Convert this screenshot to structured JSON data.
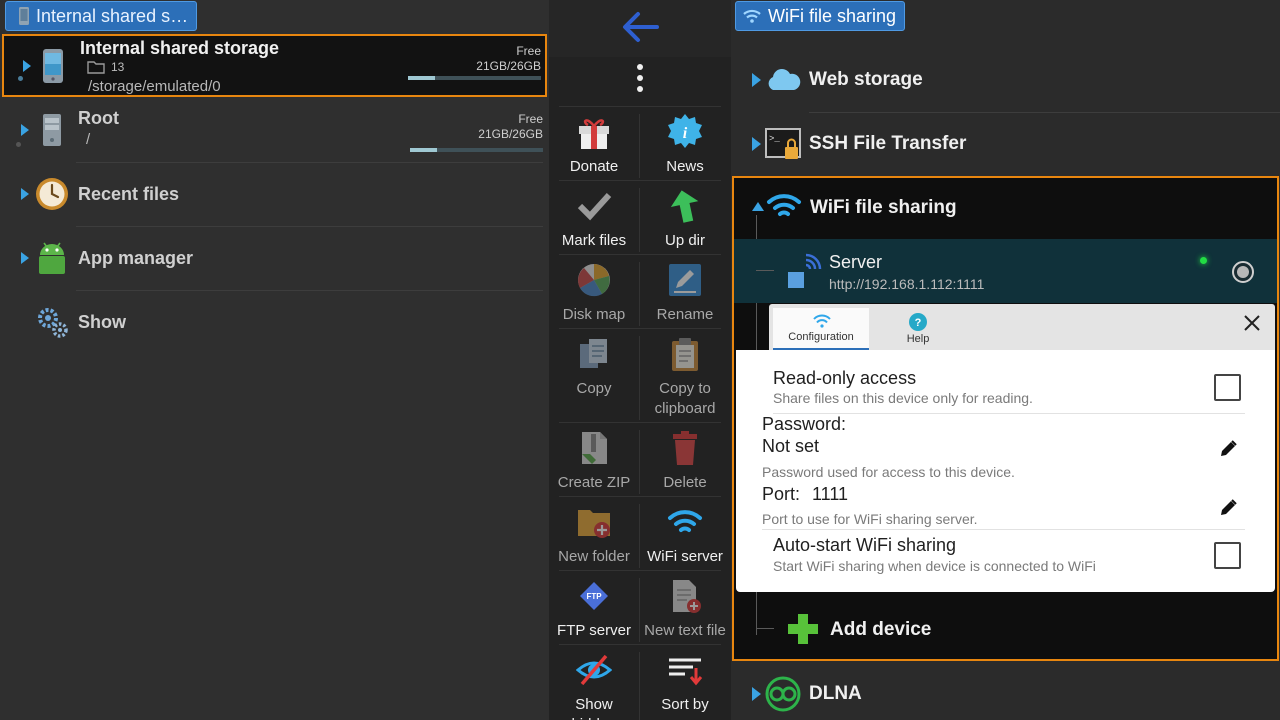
{
  "left": {
    "path_chip": "Internal shared s…",
    "items": [
      {
        "title": "Internal shared storage",
        "folder_count": "13",
        "path": "/storage/emulated/0",
        "free_label": "Free",
        "free_value": "21GB/26GB",
        "used_fraction": 0.2
      },
      {
        "title": "Root",
        "path": "/",
        "free_label": "Free",
        "free_value": "21GB/26GB",
        "used_fraction": 0.2
      },
      {
        "title": "Recent files"
      },
      {
        "title": "App manager"
      },
      {
        "title": "Show"
      }
    ]
  },
  "toolbar": {
    "buttons": [
      {
        "label": "Donate",
        "icon": "gift-icon"
      },
      {
        "label": "News",
        "icon": "info-badge-icon"
      },
      {
        "label": "Mark files",
        "icon": "checkmark-icon"
      },
      {
        "label": "Up dir",
        "icon": "up-arrow-icon"
      },
      {
        "label": "Disk map",
        "icon": "pie-chart-icon"
      },
      {
        "label": "Rename",
        "icon": "pencil-icon"
      },
      {
        "label": "Copy",
        "icon": "copy-icon"
      },
      {
        "label": "Copy to clipboard",
        "icon": "clipboard-icon"
      },
      {
        "label": "Create ZIP",
        "icon": "zip-icon"
      },
      {
        "label": "Delete",
        "icon": "trash-icon"
      },
      {
        "label": "New folder",
        "icon": "new-folder-icon"
      },
      {
        "label": "WiFi server",
        "icon": "wifi-icon"
      },
      {
        "label": "FTP server",
        "icon": "ftp-icon"
      },
      {
        "label": "New text file",
        "icon": "new-text-file-icon"
      },
      {
        "label": "Show hidden",
        "icon": "hidden-eye-icon"
      },
      {
        "label": "Sort by",
        "icon": "sort-icon"
      }
    ]
  },
  "right": {
    "chip": "WiFi file sharing",
    "rows": {
      "web_storage": "Web storage",
      "ssh": "SSH File Transfer",
      "wifi": "WiFi file sharing",
      "add_device": "Add device",
      "dlna": "DLNA"
    },
    "server": {
      "name": "Server",
      "url": "http://192.168.1.112:1111"
    }
  },
  "dialog": {
    "tabs": {
      "configuration": "Configuration",
      "help": "Help"
    },
    "readonly": {
      "title": "Read-only access",
      "desc": "Share files on this device only for reading."
    },
    "password": {
      "label": "Password",
      "colon": ":",
      "value": "Not set",
      "desc": "Password used for access to this device."
    },
    "port": {
      "label": "Port",
      "colon": ":",
      "value": "1111",
      "desc": "Port to use for WiFi sharing server."
    },
    "autostart": {
      "title": "Auto-start WiFi sharing",
      "desc": "Start WiFi sharing when device is connected to WiFi"
    }
  },
  "colors": {
    "accent": "#2c6fb8",
    "highlight_border": "#e8860f",
    "status_led": "#22dd44"
  }
}
